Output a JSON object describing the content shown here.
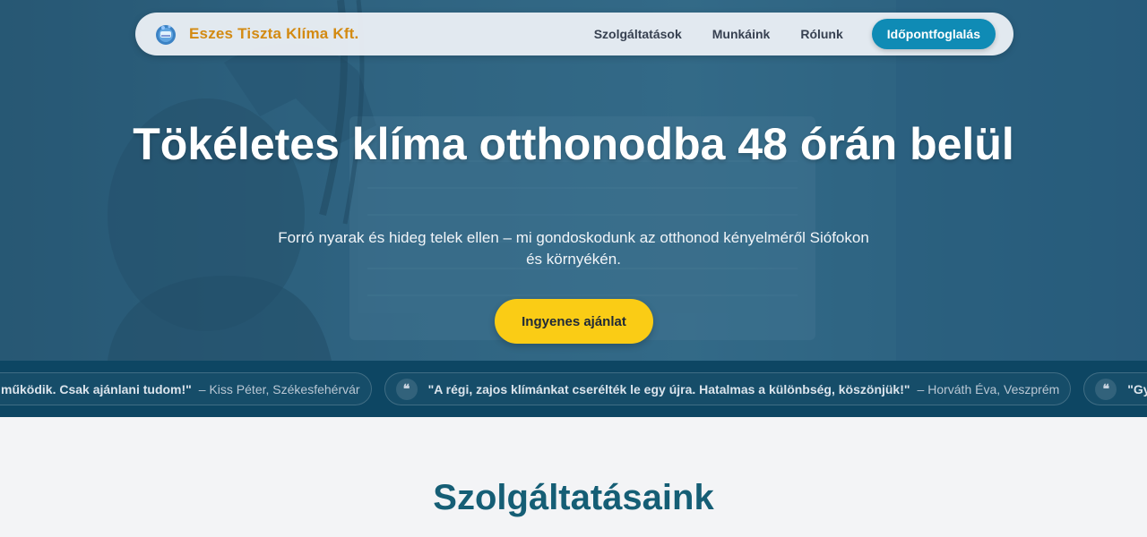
{
  "nav": {
    "brand": "Eszes Tiszta Klíma Kft.",
    "links": [
      "Szolgáltatások",
      "Munkáink",
      "Rólunk"
    ],
    "cta": "Időpontfoglalás"
  },
  "hero": {
    "title": "Tökéletes klíma otthonodba 48 órán belül",
    "subtitle": "Forró nyarak és hideg telek ellen – mi gondoskodunk az otthonod kényelméről Siófokon és környékén.",
    "cta": "Ingyenes ajánlat"
  },
  "testimonials": [
    {
      "quote": "működik. Csak ajánlani tudom!\"",
      "author": "– Kiss Péter, Székesfehérvár",
      "badge": ""
    },
    {
      "quote": "\"A régi, zajos klímánkat cserélték le egy újra. Hatalmas a különbség, köszönjük!\"",
      "author": "– Horváth Éva, Veszprém",
      "badge": "❝"
    },
    {
      "quote": "\"Gyorsak,",
      "author": "",
      "badge": "❝"
    }
  ],
  "services": {
    "title": "Szolgáltatásaink"
  },
  "colors": {
    "brand": "#d38a12",
    "primary": "#0f8bb5",
    "accent": "#facc15",
    "heading": "#155e75",
    "ticker_bg": "#0d4663"
  }
}
